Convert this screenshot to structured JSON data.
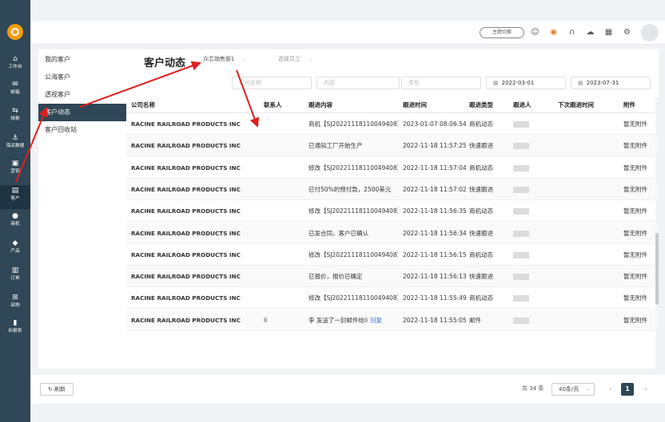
{
  "rail": {
    "items": [
      {
        "label": "工作台",
        "icon": "home-icon"
      },
      {
        "label": "邮箱",
        "icon": "mail-icon"
      },
      {
        "label": "线索",
        "icon": "clue-icon"
      },
      {
        "label": "海关数据",
        "icon": "anchor-icon"
      },
      {
        "label": "营销",
        "icon": "chat-icon"
      },
      {
        "label": "客户",
        "icon": "customer-icon",
        "active": true
      },
      {
        "label": "商机",
        "icon": "lightbulb-icon"
      },
      {
        "label": "产品",
        "icon": "cube-icon"
      },
      {
        "label": "订单",
        "icon": "order-icon"
      },
      {
        "label": "采购",
        "icon": "cart-icon"
      },
      {
        "label": "BI报表",
        "icon": "chart-icon"
      }
    ]
  },
  "header": {
    "theme_button": "主题切换",
    "icons": [
      "robot-icon",
      "brand-icon",
      "headset-icon",
      "cloud-icon",
      "calendar-icon",
      "gear-icon"
    ]
  },
  "subnav": {
    "items": [
      "我的客户",
      "公海客户",
      "透视客户",
      "客户动态",
      "客户回收站"
    ],
    "active_index": 3
  },
  "main": {
    "title": "客户动态",
    "dept_select": "众芯销售部1",
    "staff_select": "选择员工",
    "filters": {
      "company_placeholder": "公司名称",
      "content_placeholder": "内容",
      "type_placeholder": "类型",
      "start_date": "2022-03-01",
      "end_date": "2023-07-31"
    },
    "columns": [
      "公司名称",
      "联系人",
      "跟进内容",
      "跟进时间",
      "跟进类型",
      "跟进人",
      "下次跟进时间",
      "附件"
    ],
    "rows": [
      {
        "company": "RACINE RAILROAD PRODUCTS INC",
        "contact": "",
        "content": "商机【SJ20221118110049408】",
        "time": "2023-01-07 08:06:54",
        "type": "商机动态",
        "attach": "暂无附件"
      },
      {
        "company": "RACINE RAILROAD PRODUCTS INC",
        "contact": "",
        "content": "已通知工厂开始生产",
        "time": "2022-11-18 11:57:25",
        "type": "快速跟进",
        "attach": "暂无附件"
      },
      {
        "company": "RACINE RAILROAD PRODUCTS INC",
        "contact": "",
        "content": "修改【SJ20221118110049408】",
        "time": "2022-11-18 11:57:04",
        "type": "商机动态",
        "attach": "暂无附件"
      },
      {
        "company": "RACINE RAILROAD PRODUCTS INC",
        "contact": "",
        "content": "已付50%的预付款，2500美元",
        "time": "2022-11-18 11:57:02",
        "type": "快速跟进",
        "attach": "暂无附件"
      },
      {
        "company": "RACINE RAILROAD PRODUCTS INC",
        "contact": "",
        "content": "修改【SJ20221118110049408】",
        "time": "2022-11-18 11:56:35",
        "type": "商机动态",
        "attach": "暂无附件"
      },
      {
        "company": "RACINE RAILROAD PRODUCTS INC",
        "contact": "",
        "content": "已发合同，客户已确认",
        "time": "2022-11-18 11:56:34",
        "type": "快速跟进",
        "attach": "暂无附件"
      },
      {
        "company": "RACINE RAILROAD PRODUCTS INC",
        "contact": "",
        "content": "修改【SJ20221118110049408】",
        "time": "2022-11-18 11:56:15",
        "type": "商机动态",
        "attach": "暂无附件"
      },
      {
        "company": "RACINE RAILROAD PRODUCTS INC",
        "contact": "",
        "content": "已报价，报价已确定",
        "time": "2022-11-18 11:56:13",
        "type": "快速跟进",
        "attach": "暂无附件"
      },
      {
        "company": "RACINE RAILROAD PRODUCTS INC",
        "contact": "",
        "content": "修改【SJ20221118110049408】",
        "time": "2022-11-18 11:55:49",
        "type": "商机动态",
        "attach": "暂无附件"
      },
      {
        "company": "RACINE RAILROAD PRODUCTS INC",
        "contact": "li",
        "content": "李 发送了一封邮件给li",
        "content_link": "回复",
        "time": "2022-11-18 11:55:05",
        "type": "邮件",
        "attach": "暂无附件"
      }
    ]
  },
  "footer": {
    "refresh": "刷新",
    "total": "共 34 条",
    "page_size": "40条/页",
    "current_page": "1",
    "prev": "‹",
    "next": "›"
  },
  "colors": {
    "rail": "#2f4756",
    "accent": "#2f4756",
    "annotation": "#e02020"
  }
}
